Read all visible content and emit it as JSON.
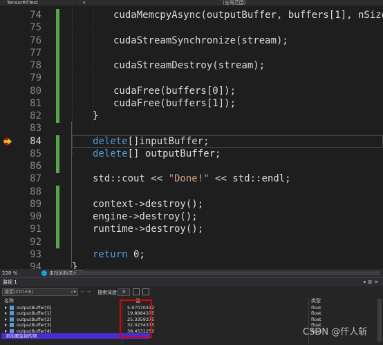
{
  "window": {
    "project": "TensorRTTest",
    "scope": "(全局范围)"
  },
  "editor": {
    "current_line": 84,
    "lines": [
      {
        "num": "74",
        "text": "cudaMemcpyAsync(outputBuffer, buffers[1], nSize1 * si",
        "changed": true
      },
      {
        "num": "75",
        "text": "",
        "changed": true
      },
      {
        "num": "76",
        "text": "cudaStreamSynchronize(stream);",
        "changed": true
      },
      {
        "num": "77",
        "text": "",
        "changed": true
      },
      {
        "num": "78",
        "text": "cudaStreamDestroy(stream);",
        "changed": true
      },
      {
        "num": "79",
        "text": "",
        "changed": true
      },
      {
        "num": "80",
        "text": "cudaFree(buffers[0]);",
        "changed": true
      },
      {
        "num": "81",
        "text": "cudaFree(buffers[1]);",
        "changed": true
      },
      {
        "num": "82",
        "text": "}",
        "changed": true
      },
      {
        "num": "83",
        "text": "",
        "changed": false
      },
      {
        "num": "84",
        "text": "delete[]inputBuffer;",
        "changed": true
      },
      {
        "num": "85",
        "text": "delete[] outputBuffer;",
        "changed": true
      },
      {
        "num": "86",
        "text": "",
        "changed": true
      },
      {
        "num": "87",
        "text": "std::cout << \"Done!\" << std::endl;",
        "changed": false
      },
      {
        "num": "88",
        "text": "",
        "changed": true
      },
      {
        "num": "89",
        "text": "context->destroy();",
        "changed": true
      },
      {
        "num": "90",
        "text": "engine->destroy();",
        "changed": true
      },
      {
        "num": "91",
        "text": "runtime->destroy();",
        "changed": true
      },
      {
        "num": "92",
        "text": "",
        "changed": true
      },
      {
        "num": "93",
        "text": "return 0;",
        "changed": false
      },
      {
        "num": "94",
        "text": "}",
        "changed": false
      }
    ]
  },
  "status": {
    "zoom": "228 %",
    "message": "未找到相关问题"
  },
  "watch": {
    "title": "监视 1",
    "search_placeholder": "搜索(Ctrl+E)",
    "depth_label": "搜索深度:",
    "depth_value": "3",
    "columns": {
      "name": "名称",
      "value": "值",
      "type": "类型"
    },
    "rows": [
      {
        "name": "outputBuffer[0]",
        "value": "5.97070312",
        "type": "float"
      },
      {
        "name": "outputBuffer[1]",
        "value": "19.8984375",
        "type": "float"
      },
      {
        "name": "outputBuffer[2]",
        "value": "25.3359375",
        "type": "float"
      },
      {
        "name": "outputBuffer[3]",
        "value": "32.0234375",
        "type": "float"
      },
      {
        "name": "outputBuffer[4]",
        "value": "38.4531250",
        "type": "float"
      }
    ],
    "add_item": "添加要监视的项"
  },
  "watermark": "CSDN @仟人斩",
  "colors": {
    "keyword": "#569cd6",
    "string": "#d69d85",
    "change_bar": "#57a64a",
    "highlight_box": "#e00000",
    "add_row": "#4b2bd2"
  }
}
